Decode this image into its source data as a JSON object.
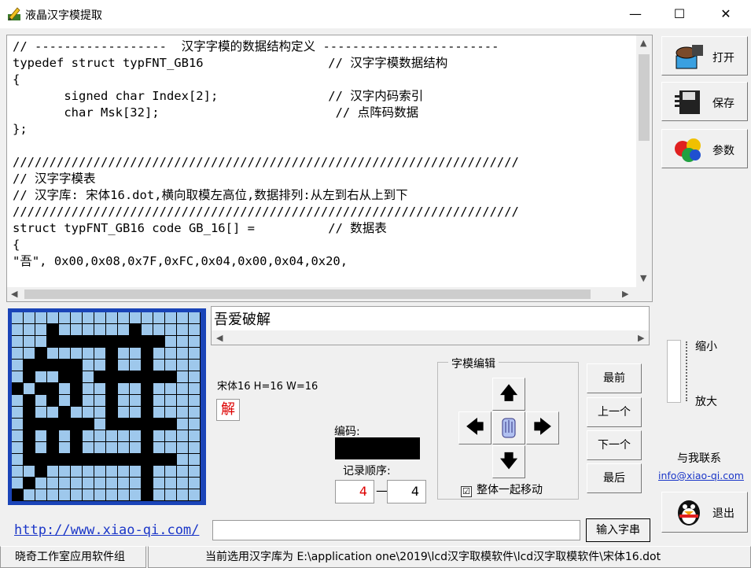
{
  "window": {
    "title": "液晶汉字模提取",
    "minimize": "—",
    "maximize": "☐",
    "close": "✕"
  },
  "code_text": "// ------------------  汉字字模的数据结构定义 ------------------------\ntypedef struct typFNT_GB16                 // 汉字字模数据结构\n{\n       signed char Index[2];               // 汉字内码索引\n       char Msk[32];                        // 点阵码数据\n};\n\n/////////////////////////////////////////////////////////////////////\n// 汉字字模表\n// 汉字库: 宋体16.dot,横向取模左高位,数据排列:从左到右从上到下\n/////////////////////////////////////////////////////////////////////\nstruct typFNT_GB16 code GB_16[] =          // 数据表\n{\n\"吾\", 0x00,0x08,0x7F,0xFC,0x04,0x00,0x04,0x20,",
  "sidebar": {
    "open": "打开",
    "save": "保存",
    "params": "参数",
    "exit": "退出"
  },
  "chars_input": "吾爱破解",
  "font_info": "宋体16 H=16 W=16",
  "current_char": "解",
  "code_label": "编码:",
  "order_label": "记录顺序:",
  "order_current": "4",
  "order_separator": "—",
  "order_total": "4",
  "edit_group": {
    "title": "字模编辑",
    "move_together": "整体一起移动",
    "checked": "☑"
  },
  "nav": {
    "first": "最前",
    "prev": "上一个",
    "next": "下一个",
    "last": "最后"
  },
  "zoom": {
    "small": "缩小",
    "big": "放大"
  },
  "contact": {
    "label": "与我联系",
    "email": "info@xiao-qi.com"
  },
  "website": "http://www.xiao-qi.com/",
  "input_button": "输入字串",
  "status": {
    "studio": "晓奇工作室应用软件组",
    "path": "当前选用汉字库为 E:\\application  one\\2019\\lcd汉字取模软件\\lcd汉字取模软件\\宋体16.dot"
  },
  "glyph_rows": [
    "0000000000000000",
    "0001000000100000",
    "0001111111111000",
    "0010000010010000",
    "0111110010010000",
    "0100110111111100",
    "1011010010010000",
    "0101010010010000",
    "0100100010010000",
    "0111111011111100",
    "0101010000010000",
    "0101010000010000",
    "0111111111111100",
    "0010000000010000",
    "0100000000010000",
    "1000000000010000"
  ],
  "colors": {
    "grid_on": "#000000",
    "grid_off": "#9ec8ec",
    "grid_border": "#1a44b8",
    "link": "#1a36c8",
    "accent_red": "#dd0000"
  }
}
